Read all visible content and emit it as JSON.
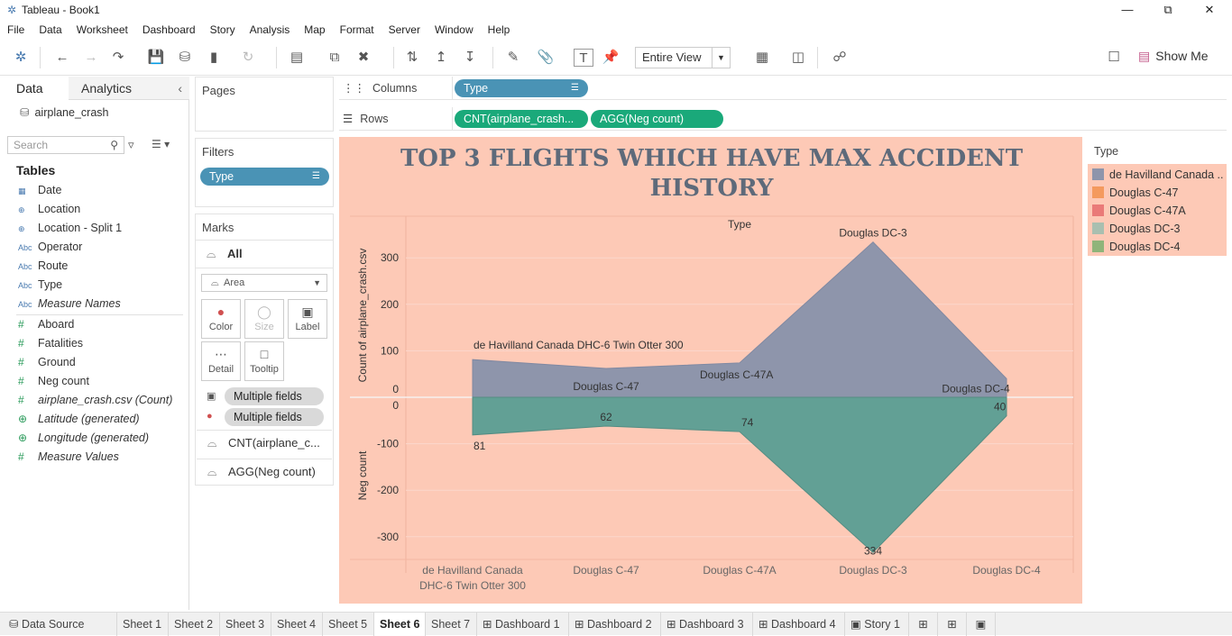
{
  "window": {
    "title": "Tableau - Book1"
  },
  "menu": [
    "File",
    "Data",
    "Worksheet",
    "Dashboard",
    "Story",
    "Analysis",
    "Map",
    "Format",
    "Server",
    "Window",
    "Help"
  ],
  "toolbar": {
    "view_select": "Entire View",
    "show_me": "Show Me"
  },
  "data_pane": {
    "tab_data": "Data",
    "tab_analytics": "Analytics",
    "datasource": "airplane_crash",
    "search_placeholder": "Search",
    "tables_header": "Tables",
    "fields": [
      {
        "icon": "calendar-icon",
        "type": "",
        "name": "Date",
        "italic": false
      },
      {
        "icon": "globe-icon",
        "type": "",
        "name": "Location",
        "italic": false
      },
      {
        "icon": "globe-icon",
        "type": "",
        "name": "Location - Split 1",
        "italic": false
      },
      {
        "icon": "abc-icon",
        "type": "Abc",
        "name": "Operator",
        "italic": false
      },
      {
        "icon": "abc-icon",
        "type": "Abc",
        "name": "Route",
        "italic": false
      },
      {
        "icon": "abc-icon",
        "type": "Abc",
        "name": "Type",
        "italic": false
      },
      {
        "icon": "abc-icon",
        "type": "Abc",
        "name": "Measure Names",
        "italic": true
      },
      {
        "icon": "hash-icon",
        "type": "#",
        "name": "Aboard",
        "italic": false
      },
      {
        "icon": "hash-icon",
        "type": "#",
        "name": "Fatalities",
        "italic": false
      },
      {
        "icon": "hash-icon",
        "type": "#",
        "name": "Ground",
        "italic": false
      },
      {
        "icon": "hash-icon",
        "type": "#",
        "name": "Neg count",
        "italic": false
      },
      {
        "icon": "hash-icon",
        "type": "#",
        "name": "airplane_crash.csv (Count)",
        "italic": true
      },
      {
        "icon": "globe-icon",
        "type": "",
        "name": "Latitude (generated)",
        "italic": true
      },
      {
        "icon": "globe-icon",
        "type": "",
        "name": "Longitude (generated)",
        "italic": true
      },
      {
        "icon": "hash-icon",
        "type": "#",
        "name": "Measure Values",
        "italic": true
      }
    ]
  },
  "shelves": {
    "pages_label": "Pages",
    "filters_label": "Filters",
    "filter_pill": "Type",
    "columns_label": "Columns",
    "rows_label": "Rows",
    "column_pill": "Type",
    "row_pill_1": "CNT(airplane_crash...",
    "row_pill_2": "AGG(Neg count)"
  },
  "marks": {
    "header": "Marks",
    "all_label": "All",
    "mark_type": "Area",
    "buttons": {
      "color": "Color",
      "size": "Size",
      "label": "Label",
      "detail": "Detail",
      "tooltip": "Tooltip"
    },
    "field_1": "Multiple fields",
    "field_2": "Multiple fields",
    "measure_1": "CNT(airplane_c...",
    "measure_2": "AGG(Neg count)"
  },
  "legend": {
    "title": "Type",
    "items": [
      {
        "label": "de Havilland Canada ..",
        "color": "#8e95ab"
      },
      {
        "label": "Douglas C-47",
        "color": "#f49a5e"
      },
      {
        "label": "Douglas C-47A",
        "color": "#ea7a78"
      },
      {
        "label": "Douglas DC-3",
        "color": "#a9bfb0"
      },
      {
        "label": "Douglas DC-4",
        "color": "#8fb47a"
      }
    ]
  },
  "chart_data": {
    "type": "area",
    "title": "TOP 3 FLIGHTS WHICH HAVE MAX ACCIDENT HISTORY",
    "column_header": "Type",
    "categories": [
      "de Havilland Canada DHC-6 Twin Otter 300",
      "Douglas C-47",
      "Douglas C-47A",
      "Douglas DC-3",
      "Douglas DC-4"
    ],
    "x_tick_labels": [
      "de Havilland Canada\nDHC-6 Twin Otter 300",
      "Douglas C-47",
      "Douglas C-47A",
      "Douglas DC-3",
      "Douglas DC-4"
    ],
    "series": [
      {
        "name": "Count of airplane_crash.csv",
        "values": [
          81,
          62,
          74,
          334,
          40
        ],
        "color": "#8e95ab",
        "labels": [
          "de Havilland Canada DHC-6 Twin Otter 300",
          "Douglas C-47",
          "Douglas C-47A",
          "Douglas DC-3",
          "Douglas DC-4"
        ]
      },
      {
        "name": "Neg count",
        "values": [
          -81,
          -62,
          -74,
          -334,
          -40
        ],
        "color": "#62a095",
        "labels": [
          "81",
          "62",
          "74",
          "334",
          "40"
        ]
      }
    ],
    "top_panel": {
      "ylabel": "Count of airplane_crash.csv",
      "ylim": [
        0,
        340
      ],
      "ticks": [
        0,
        100,
        200,
        300
      ]
    },
    "bottom_panel": {
      "ylabel": "Neg count",
      "ylim": [
        -340,
        0
      ],
      "ticks": [
        0,
        -100,
        -200,
        -300
      ]
    },
    "background": "#fdc9b6",
    "grid": true
  },
  "sheet_tabs": {
    "data_source": "Data Source",
    "sheets": [
      "Sheet 1",
      "Sheet 2",
      "Sheet 3",
      "Sheet 4",
      "Sheet 5",
      "Sheet 6",
      "Sheet 7"
    ],
    "active": "Sheet 6",
    "dashboards": [
      "Dashboard 1",
      "Dashboard 2",
      "Dashboard 3",
      "Dashboard 4"
    ],
    "stories": [
      "Story 1"
    ]
  }
}
